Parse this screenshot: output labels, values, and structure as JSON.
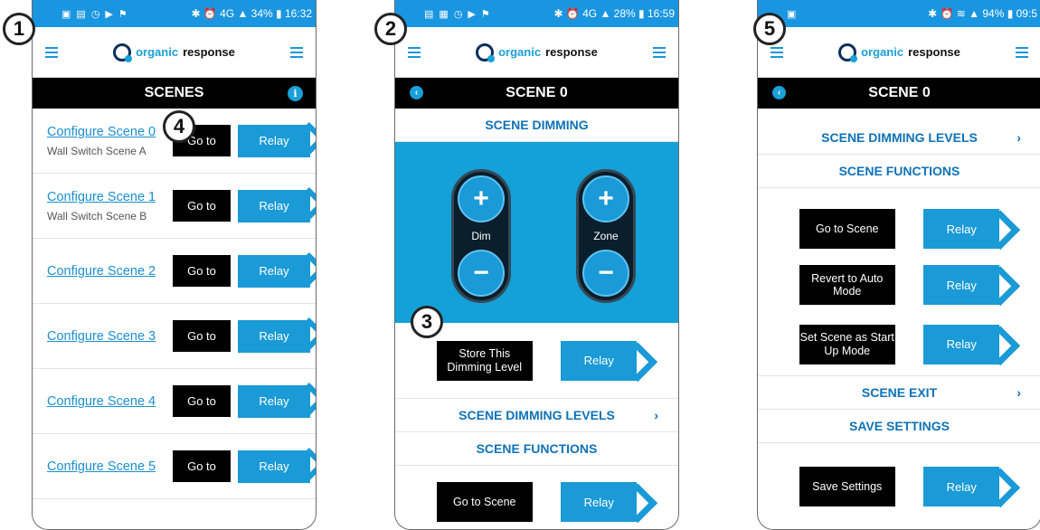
{
  "phone1": {
    "status": {
      "icons": [
        "sms",
        "photo",
        "image",
        "alarm",
        "play",
        "flag"
      ],
      "right": "✱ ⏰ 4G ▲ 34% ▮ 16:32"
    },
    "brand": {
      "pre": "organic",
      "post": "response"
    },
    "title": "SCENES",
    "rows": [
      {
        "link": "Configure Scene 0",
        "sub": "Wall Switch Scene A",
        "goto": "Go to",
        "relay": "Relay"
      },
      {
        "link": "Configure Scene 1",
        "sub": "Wall Switch Scene B",
        "goto": "Go to",
        "relay": "Relay"
      },
      {
        "link": "Configure Scene 2",
        "sub": "",
        "goto": "Go to",
        "relay": "Relay"
      },
      {
        "link": "Configure Scene 3",
        "sub": "",
        "goto": "Go to",
        "relay": "Relay"
      },
      {
        "link": "Configure Scene 4",
        "sub": "",
        "goto": "Go to",
        "relay": "Relay"
      },
      {
        "link": "Configure Scene 5",
        "sub": "",
        "goto": "Go to",
        "relay": "Relay"
      }
    ]
  },
  "phone2": {
    "status": {
      "right": "✱ ⏰ 4G ▲ 28% ▮ 16:59"
    },
    "brand": {
      "pre": "organic",
      "post": "response"
    },
    "title": "SCENE 0",
    "dimming": "SCENE DIMMING",
    "dim": "Dim",
    "zone": "Zone",
    "plus": "+",
    "minus": "−",
    "store": "Store This Dimming Level",
    "relay": "Relay",
    "levels": "SCENE DIMMING LEVELS",
    "functions": "SCENE FUNCTIONS",
    "goto_scene": "Go to Scene"
  },
  "phone3": {
    "status": {
      "right": "✱ ⏰ ≋ ▲ 94% ▮ 09:5"
    },
    "brand": {
      "pre": "organic",
      "post": "response"
    },
    "title": "SCENE 0",
    "levels": "SCENE DIMMING LEVELS",
    "functions": "SCENE FUNCTIONS",
    "goto_scene": "Go to Scene",
    "revert": "Revert to Auto Mode",
    "startup": "Set Scene as Start Up Mode",
    "relay": "Relay",
    "exit": "SCENE EXIT",
    "save_head": "SAVE SETTINGS",
    "save_btn": "Save Settings"
  },
  "badges": {
    "b1": "1",
    "b2": "2",
    "b3": "3",
    "b4": "4",
    "b5": "5"
  },
  "chev": "›"
}
